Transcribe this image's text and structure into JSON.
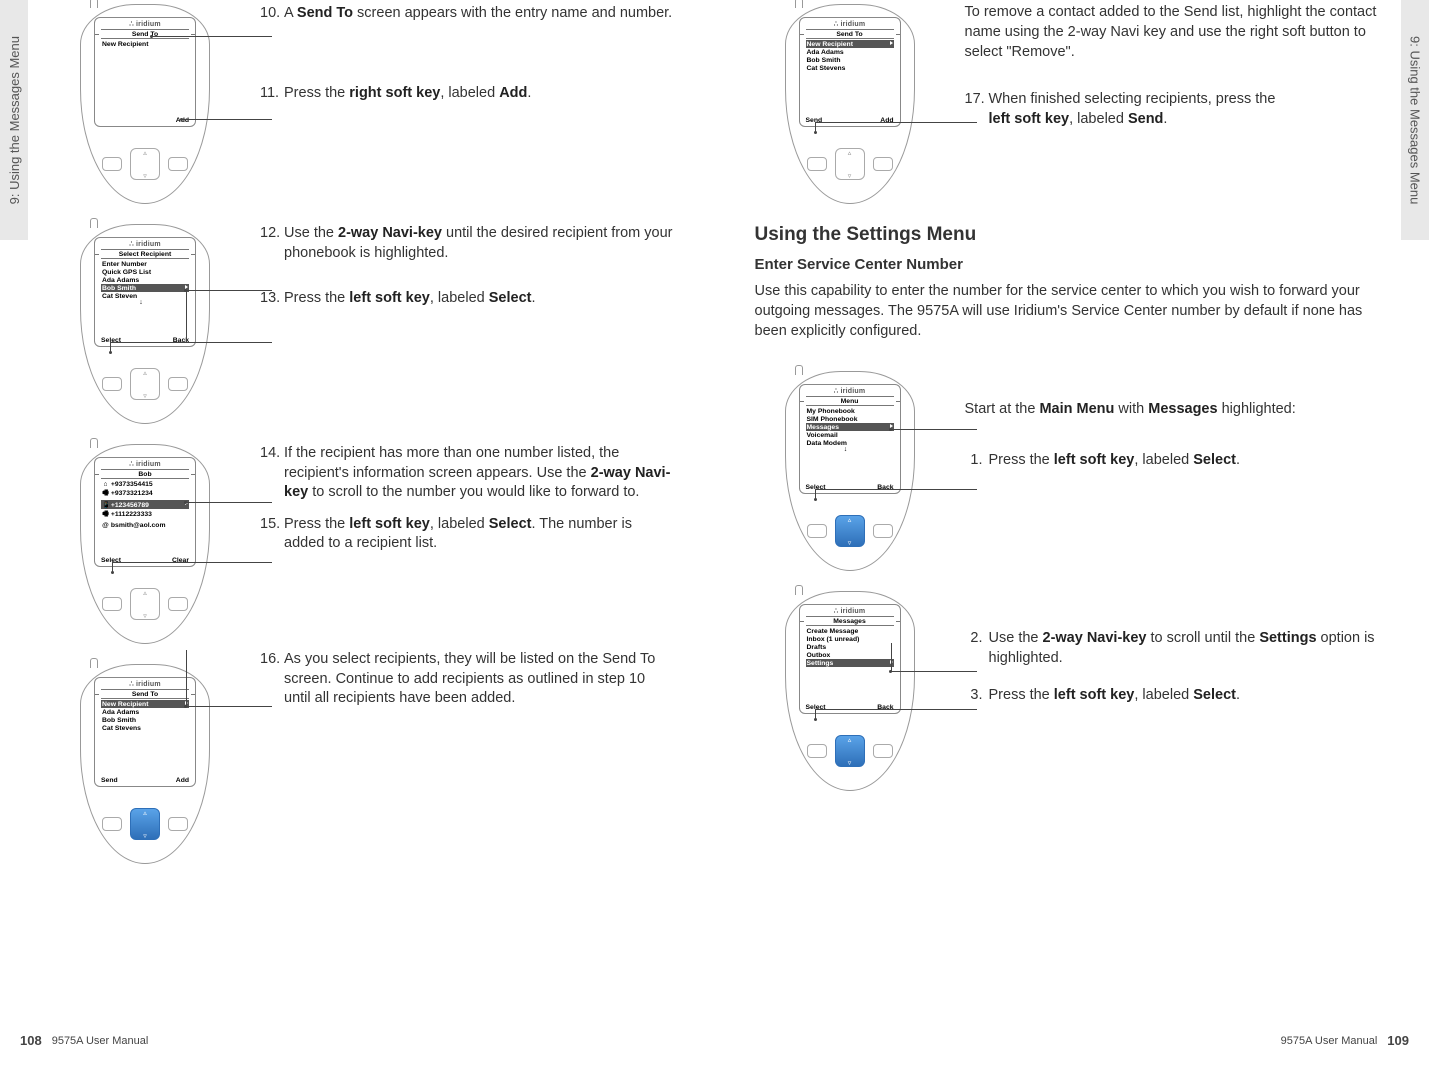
{
  "doc": {
    "title": "9575A User Manual",
    "chapter": "9: Using the Messages Menu"
  },
  "pages": {
    "left": "108",
    "right": "109"
  },
  "brand": "iridium",
  "screens": {
    "s10": {
      "title": "Send To",
      "items": [
        "New Recipient"
      ],
      "left": "",
      "right": "Add"
    },
    "s12": {
      "title": "Select Recipient",
      "items": [
        "Enter Number",
        "Quick GPS List",
        "Ada Adams",
        "Bob Smith",
        "Cat Steven"
      ],
      "selIndex": 3,
      "left": "Select",
      "right": "Back",
      "arrow": true
    },
    "s14": {
      "title": "Bob",
      "items": [
        "+9373354415",
        "+9373321234",
        "+123456789",
        "+1112223333",
        "bsmith@aol.com"
      ],
      "icons": [
        "⌂",
        "🖷",
        "📱",
        "🖷",
        "@"
      ],
      "selIndex": 2,
      "left": "Select",
      "right": "Clear"
    },
    "s16": {
      "title": "Send To",
      "items": [
        "New Recipient",
        "Ada Adams",
        "Bob Smith",
        "Cat Stevens"
      ],
      "selIndex": 0,
      "left": "Send",
      "right": "Add"
    },
    "s17": {
      "title": "Send To",
      "items": [
        "New Recipient",
        "Ada Adams",
        "Bob Smith",
        "Cat Stevens"
      ],
      "selIndex": 0,
      "left": "Send",
      "right": "Add"
    },
    "sMenu": {
      "title": "Menu",
      "items": [
        "My Phonebook",
        "SIM Phonebook",
        "Messages",
        "Voicemail",
        "Data Modem"
      ],
      "selIndex": 2,
      "left": "Select",
      "right": "Back",
      "arrow": true
    },
    "sMsg": {
      "title": "Messages",
      "items": [
        "Create Message",
        "Inbox (1 unread)",
        "Drafts",
        "Outbox",
        "Settings"
      ],
      "selIndex": 4,
      "left": "Select",
      "right": "Back"
    }
  },
  "steps": {
    "t10": {
      "n": "10.",
      "a": "A ",
      "b": "Send To",
      "c": " screen appears with the entry name and number."
    },
    "t11": {
      "n": "11.",
      "a": "Press the ",
      "b": "right soft key",
      "c": ", labeled ",
      "d": "Add",
      "e": "."
    },
    "t12": {
      "n": "12.",
      "a": "Use the ",
      "b": "2-way Navi-key",
      "c": " until the desired recipient from your phonebook is highlighted."
    },
    "t13": {
      "n": "13.",
      "a": "Press the ",
      "b": "left soft key",
      "c": ", labeled ",
      "d": "Select",
      "e": "."
    },
    "t14": {
      "n": "14.",
      "c": "If the recipient has more than one number listed, the recipient's information screen appears. Use the ",
      "b": "2-way Navi-key",
      "d": " to scroll to the number you would like to forward to."
    },
    "t15": {
      "n": "15.",
      "a": "Press the ",
      "b": "left soft key",
      "c": ", labeled ",
      "d": "Select",
      "e": ". The number is added to a recipient list."
    },
    "t16": {
      "n": "16.",
      "c": "As you select recipients, they will be listed on the Send To screen. Continue to add recipients as outlined in step 10 until all recipients have been added."
    },
    "tRem": {
      "c": "To remove a contact added to the Send list, highlight the contact name using the 2-way Navi key and use the right soft button to select \"Remove\"."
    },
    "t17": {
      "n": "17.",
      "a": "When finished selecting recipients, press the ",
      "b": "left soft key",
      "c": ", labeled ",
      "d": "Send",
      "e": "."
    },
    "h2": "Using the Settings Menu",
    "h3": "Enter Service Center Number",
    "p1": "Use this capability to enter the number for the service center to which you wish to forward your outgoing messages. The 9575A will use Iridium's Service Center number by default if none has been explicitly configured.",
    "mIntro": {
      "a": "Start at the ",
      "b": "Main Menu",
      "c": " with ",
      "d": "Messages",
      "e": " highlighted:"
    },
    "m1": {
      "n": "1.",
      "a": "Press the ",
      "b": "left soft key",
      "c": ", labeled ",
      "d": "Select",
      "e": "."
    },
    "m2": {
      "n": "2.",
      "a": "Use the ",
      "b": "2-way Navi-key",
      "c": " to scroll until the ",
      "d": "Settings",
      "e": " option is highlighted."
    },
    "m3": {
      "n": "3.",
      "a": "Press the ",
      "b": "left soft key",
      "c": ", labeled ",
      "d": "Select",
      "e": "."
    }
  }
}
